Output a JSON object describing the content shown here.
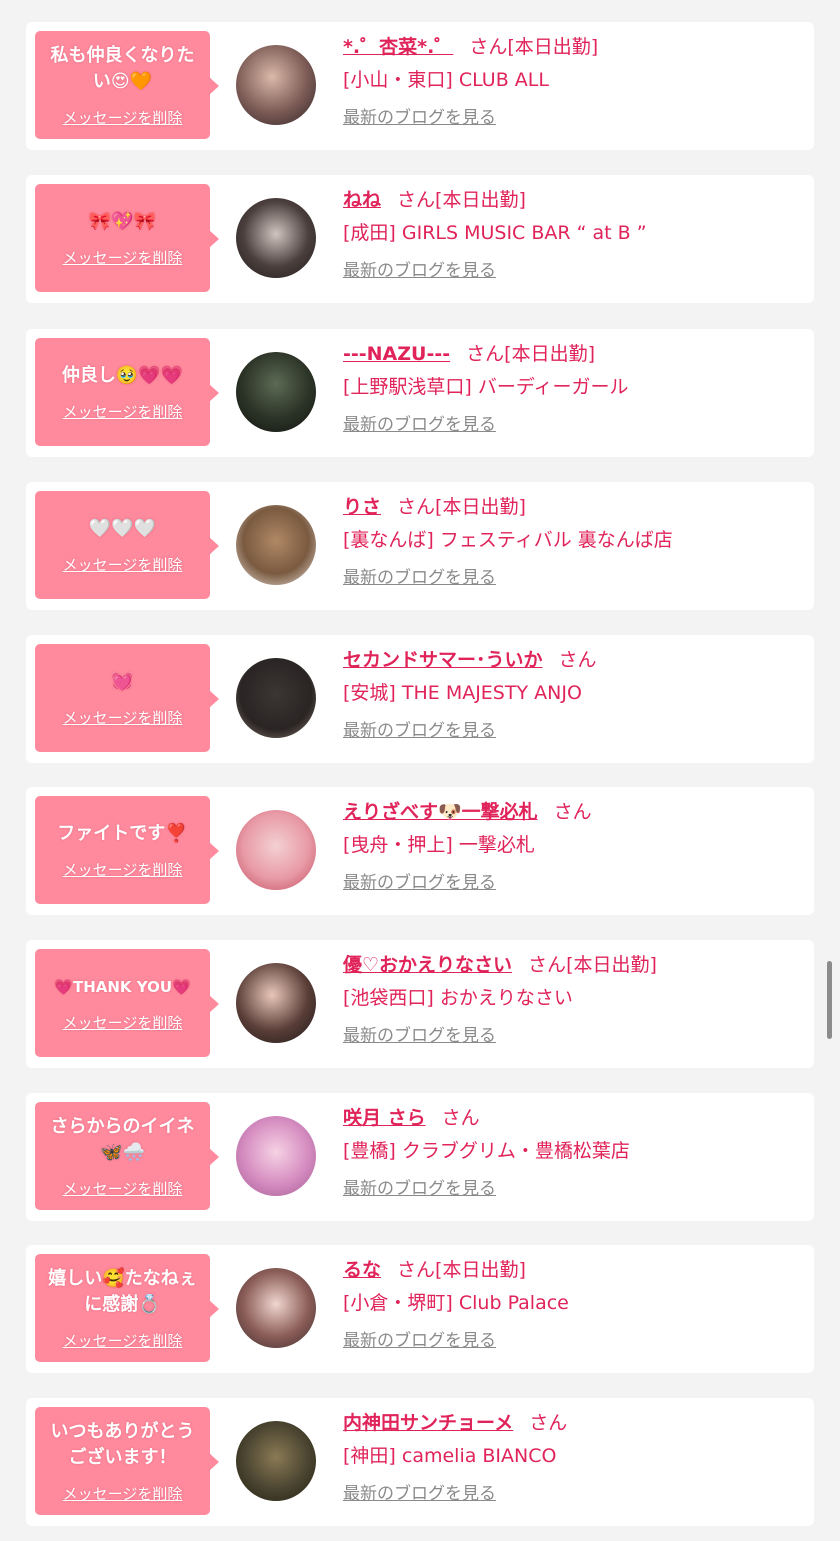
{
  "ui": {
    "delete_label": "メッセージを削除",
    "blog_label": "最新のブログを見る",
    "san_label": "さん",
    "attend_label": "[本日出勤]"
  },
  "colors": {
    "bubble": "#ff8a9d",
    "accent": "#e0245a",
    "muted": "#8a8a8a",
    "page_bg": "#f3f3f3"
  },
  "items": [
    {
      "message": "私も仲良くなりた\nい😍🧡",
      "name": "*.゜杏菜*.゜",
      "attendance": true,
      "area": "[小山・東口]",
      "shop": "CLUB ALL"
    },
    {
      "message": "🎀💖🎀",
      "name": "ねね",
      "attendance": true,
      "area": "[成田]",
      "shop": "GIRLS MUSIC BAR “ at B ”"
    },
    {
      "message": "仲良し🥹💗💗",
      "name": "---NAZU---",
      "attendance": true,
      "area": "[上野駅浅草口]",
      "shop": "バーディーガール"
    },
    {
      "message": "🤍🤍🤍",
      "name": "りさ",
      "attendance": true,
      "area": "[裏なんば]",
      "shop": "フェスティバル 裏なんば店"
    },
    {
      "message": "💓",
      "name": "セカンドサマー･ういか",
      "attendance": false,
      "area": "[安城]",
      "shop": "THE MAJESTY ANJO"
    },
    {
      "message": "ファイトです❣️",
      "name": "えりざべす🐶一撃必札",
      "attendance": false,
      "area": "[曳舟・押上]",
      "shop": "一撃必札"
    },
    {
      "message": "💗THANK YOU💗",
      "name": "優♡おかえりなさい",
      "attendance": true,
      "area": "[池袋西口]",
      "shop": "おかえりなさい"
    },
    {
      "message": "さらからのイイネ\n🦋🌨️",
      "name": "咲月 さら",
      "attendance": false,
      "area": "[豊橋]",
      "shop": "クラブグリム・豊橋松葉店"
    },
    {
      "message": "嬉しい🥰たなねぇ\nに感謝💍",
      "name": "るな",
      "attendance": true,
      "area": "[小倉・堺町]",
      "shop": "Club Palace"
    },
    {
      "message": "いつもありがとう\nございます！",
      "name": "内神田サンチョーメ",
      "attendance": false,
      "area": "[神田]",
      "shop": "camelia BIANCO"
    }
  ]
}
